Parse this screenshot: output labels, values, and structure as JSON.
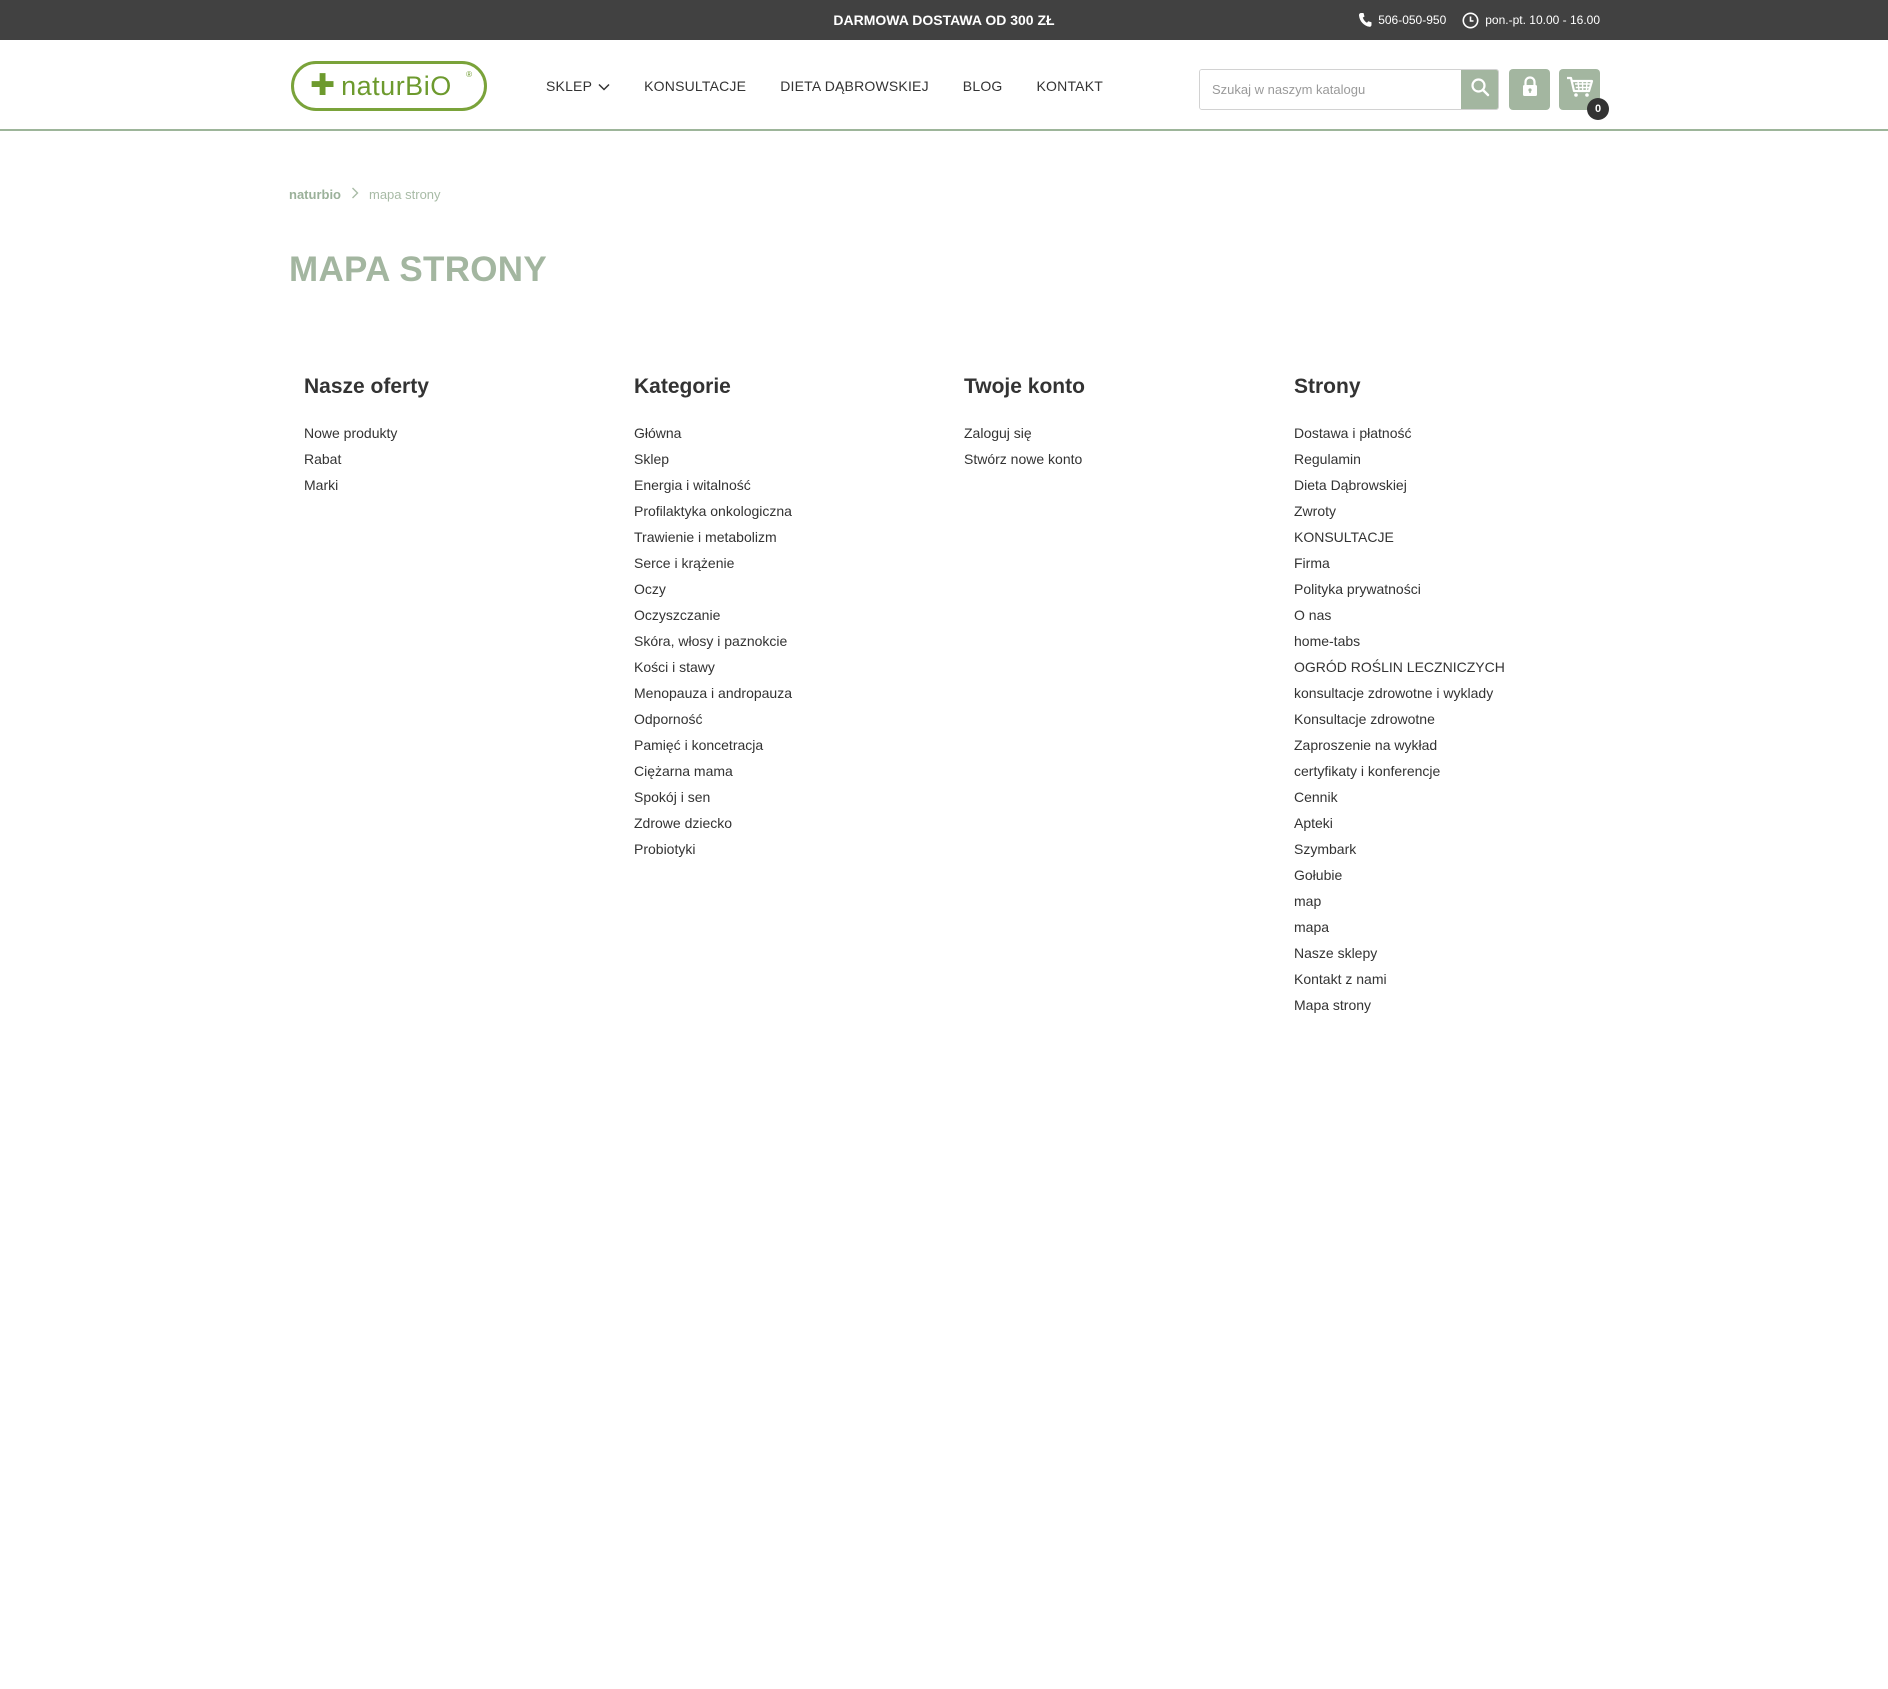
{
  "topbar": {
    "promo": "DARMOWA DOSTAWA OD 300 ZŁ",
    "phone": "506-050-950",
    "hours": "pon.-pt. 10.00 - 16.00"
  },
  "header": {
    "logo_text": "naturBiO",
    "nav": [
      {
        "label": "SKLEP"
      },
      {
        "label": "KONSULTACJE"
      },
      {
        "label": "DIETA DĄBROWSKIEJ"
      },
      {
        "label": "BLOG"
      },
      {
        "label": "KONTAKT"
      }
    ],
    "search_placeholder": "Szukaj w naszym katalogu",
    "cart_count": "0"
  },
  "breadcrumb": {
    "home": "naturbio",
    "current": "mapa strony"
  },
  "page_title": "MAPA STRONY",
  "sitemap": {
    "offers": {
      "title": "Nasze oferty",
      "items": [
        "Nowe produkty",
        "Rabat",
        "Marki"
      ]
    },
    "categories": {
      "title": "Kategorie",
      "items": [
        "Główna",
        "Sklep",
        "Energia i witalność",
        "Profilaktyka onkologiczna",
        "Trawienie i metabolizm",
        "Serce i krążenie",
        "Oczy",
        "Oczyszczanie",
        "Skóra, włosy i paznokcie",
        "Kości i stawy",
        "Menopauza i andropauza",
        "Odporność",
        "Pamięć i koncetracja",
        "Ciężarna mama",
        "Spokój i sen",
        "Zdrowe dziecko",
        "Probiotyki"
      ]
    },
    "account": {
      "title": "Twoje konto",
      "items": [
        "Zaloguj się",
        "Stwórz nowe konto"
      ]
    },
    "pages": {
      "title": "Strony",
      "items": [
        "Dostawa i płatność",
        "Regulamin",
        "Dieta Dąbrowskiej",
        "Zwroty",
        "KONSULTACJE",
        "Firma",
        "Polityka prywatności",
        "O nas",
        "home-tabs",
        "OGRÓD ROŚLIN LECZNICZYCH",
        "konsultacje zdrowotne i wyklady",
        "Konsultacje zdrowotne",
        "Zaproszenie na wykład",
        "certyfikaty i konferencje",
        "Cennik",
        "Apteki",
        "Szymbark",
        "Gołubie",
        "map",
        "mapa",
        "Nasze sklepy",
        "Kontakt z nami",
        "Mapa strony"
      ]
    }
  },
  "colors": {
    "topbar_bg": "#414141",
    "accent": "#a3b6a0",
    "logo_green": "#6d9a2e",
    "text": "#333333"
  },
  "icons": {
    "phone": "phone-icon",
    "clock": "clock-icon",
    "search": "search-icon",
    "account": "lock-icon",
    "cart": "cart-icon",
    "dropdown": "chevron-down-icon",
    "breadcrumb_separator": "chevron-right-icon"
  }
}
